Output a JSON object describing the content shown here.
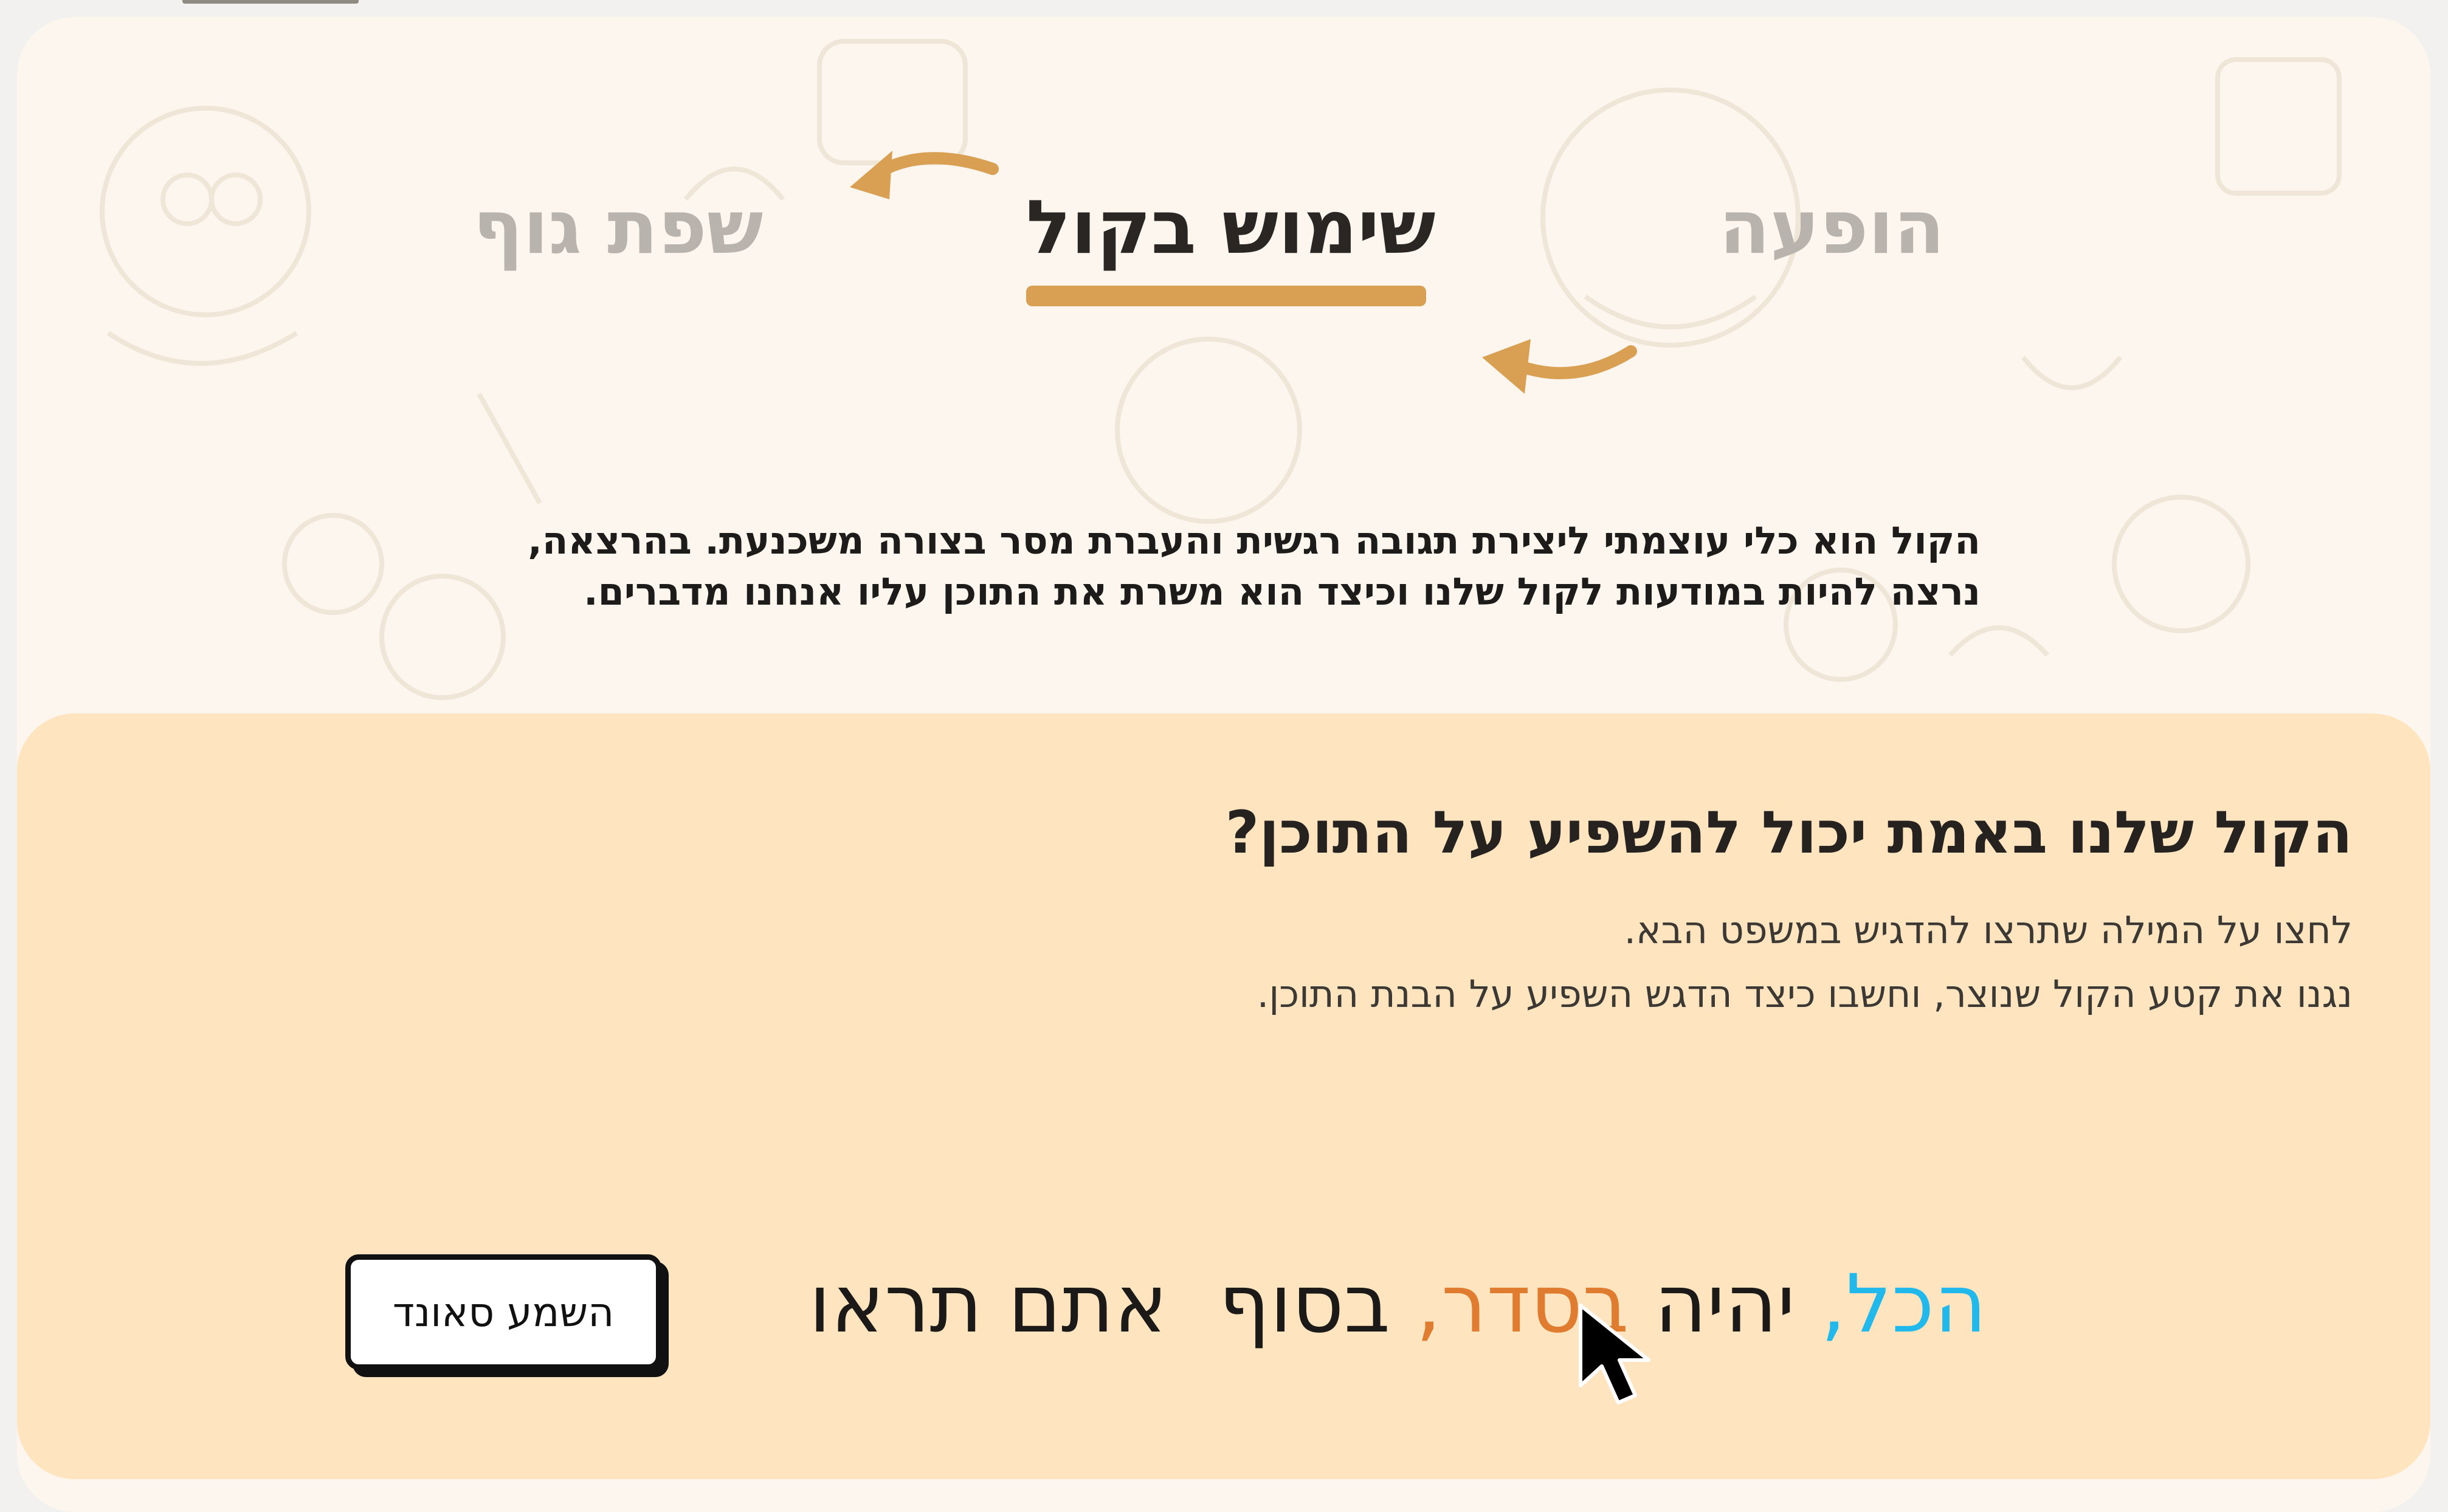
{
  "tabs": [
    {
      "label": "הופעה",
      "active": false
    },
    {
      "label": "שימוש בקול",
      "active": true
    },
    {
      "label": "שפת גוף",
      "active": false
    }
  ],
  "intro": {
    "line1": "הקול הוא כלי עוצמתי ליצירת תגובה רגשית והעברת מסר בצורה משכנעת. בהרצאה,",
    "line2": "נרצה להיות במודעות לקול שלנו וכיצד הוא משרת את התוכן עליו אנחנו מדברים."
  },
  "panel": {
    "title": "הקול שלנו באמת יכול להשפיע על התוכן?",
    "line1": "לחצו על המילה שתרצו להדגיש במשפט הבא.",
    "line2": "נגנו את קטע הקול שנוצר, וחשבו כיצד הדגש השפיע על הבנת התוכן."
  },
  "sentence": {
    "w1": "הכל",
    "w2": "יהיה",
    "w3": "בסדר",
    "w4": "בסוף",
    "w5": "אתם תראו",
    "comma": ","
  },
  "play_button": {
    "label": "השמע סאונד"
  },
  "colors": {
    "accent": "#d9a053",
    "panel_bg": "#ffe5bf",
    "page_bg": "#fcf6ee",
    "highlight_blue": "#21b8ec",
    "highlight_orange": "#e07c30"
  },
  "icons": [
    "curved-arrow-icon",
    "mouse-pointer-icon"
  ]
}
